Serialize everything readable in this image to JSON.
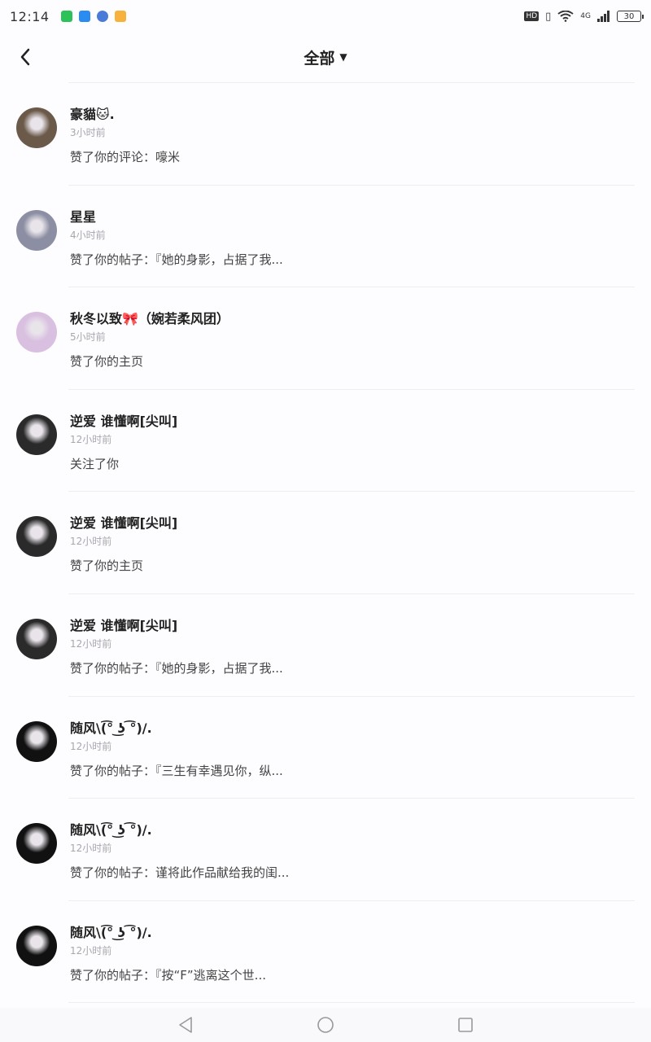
{
  "status_bar": {
    "time": "12:14",
    "network": "4G",
    "battery": "30",
    "hd_label": "HD"
  },
  "header": {
    "filter_label": "全部",
    "back_icon": "chevron-left-icon",
    "caret_icon": "caret-down-icon"
  },
  "notifications": [
    {
      "name": "豪貓🐱.",
      "time": "3小时前",
      "action": "赞了你的评论：嚎米",
      "avatar_color": "#6b5a4a"
    },
    {
      "name": "星星",
      "time": "4小时前",
      "action": "赞了你的帖子：『她的身影，占据了我...",
      "avatar_color": "#8c8ea3"
    },
    {
      "name": "秋冬以致🎀（婉若柔风团）",
      "time": "5小时前",
      "action": "赞了你的主页",
      "avatar_color": "#d9bfe0"
    },
    {
      "name": "逆爱 谁懂啊[尖叫]",
      "time": "12小时前",
      "action": "关注了你",
      "avatar_color": "#2a2a2a"
    },
    {
      "name": "逆爱 谁懂啊[尖叫]",
      "time": "12小时前",
      "action": "赞了你的主页",
      "avatar_color": "#2a2a2a"
    },
    {
      "name": "逆爱 谁懂啊[尖叫]",
      "time": "12小时前",
      "action": "赞了你的帖子：『她的身影，占据了我...",
      "avatar_color": "#2a2a2a"
    },
    {
      "name": "随风\\(͡° ͜ʖ ͡°)/.",
      "time": "12小时前",
      "action": "赞了你的帖子：『三生有幸遇见你，纵...",
      "avatar_color": "#111111"
    },
    {
      "name": "随风\\(͡° ͜ʖ ͡°)/.",
      "time": "12小时前",
      "action": "赞了你的帖子：谨将此作品献给我的闺...",
      "avatar_color": "#111111"
    },
    {
      "name": "随风\\(͡° ͜ʖ ͡°)/.",
      "time": "12小时前",
      "action": "赞了你的帖子：『按“F”逃离这个世...",
      "avatar_color": "#111111"
    }
  ],
  "colors": {
    "background": "#fdfcfe",
    "divider": "#efedf2",
    "secondary_text": "#a9a7ae"
  }
}
